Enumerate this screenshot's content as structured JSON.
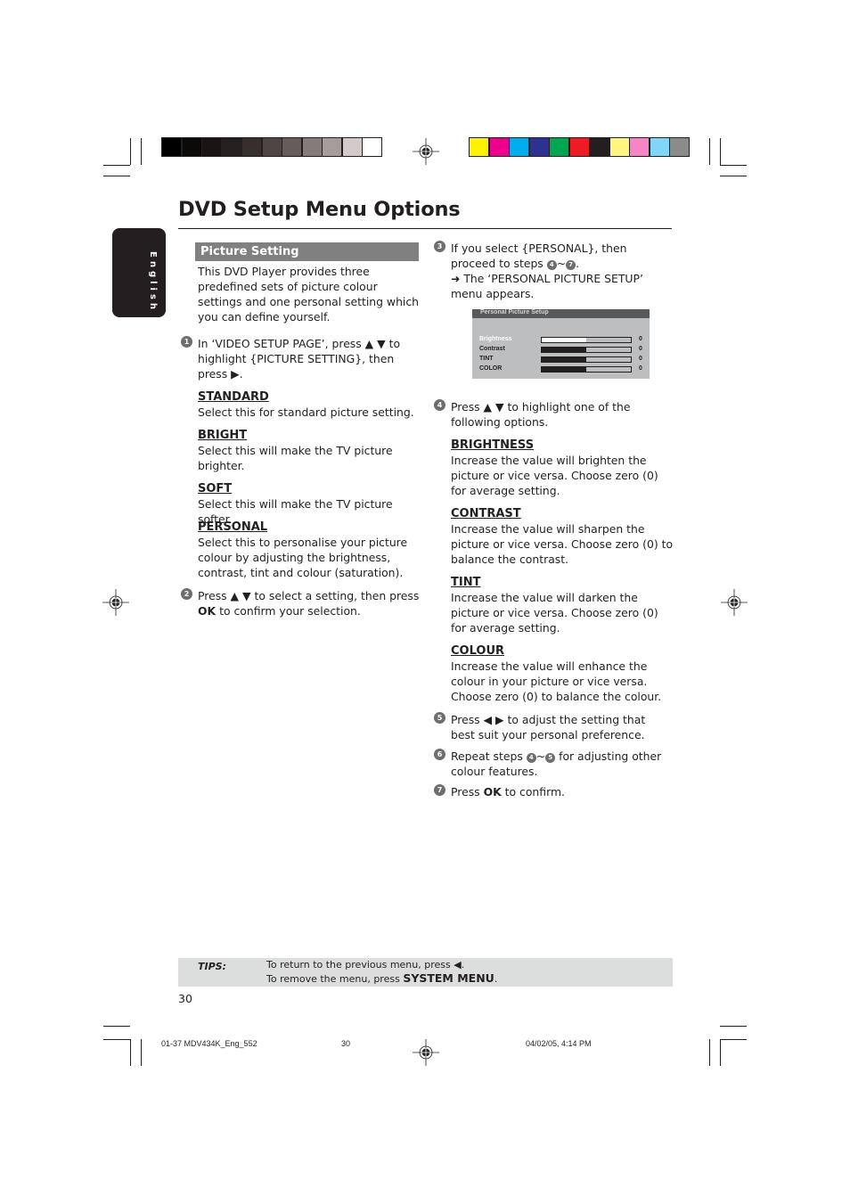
{
  "title": "DVD Setup Menu Options",
  "language_tab": "English",
  "colors": {
    "grayscale_swatches": [
      "#000000",
      "#0c0a09",
      "#1a1514",
      "#242020",
      "#372f2e",
      "#4f4543",
      "#665c5a",
      "#857b79",
      "#a59c9b",
      "#d2c9c8",
      "#ffffff"
    ],
    "color_swatches": [
      "#fff200",
      "#ec008c",
      "#00aeef",
      "#2e3192",
      "#00a651",
      "#ed1c24",
      "#231f20",
      "#fff57f",
      "#f784c5",
      "#7fd6f7",
      "#8c8b8b"
    ],
    "section_header_bg": "#808080",
    "tips_bg": "#dcdddd"
  },
  "left": {
    "section_header": "Picture Setting",
    "intro": "This DVD Player provides three predefined sets of picture colour settings and one personal setting which you can define yourself.",
    "step1": {
      "num": "1",
      "text": "In ‘VIDEO SETUP PAGE’, press ▲ ▼ to highlight {PICTURE SETTING}, then press ▶."
    },
    "options": [
      {
        "head": "STANDARD",
        "text": "Select this for standard picture setting."
      },
      {
        "head": "BRIGHT",
        "text": "Select this will make the TV picture brighter."
      },
      {
        "head": "SOFT",
        "text": "Select this will make the TV picture softer."
      },
      {
        "head": "PERSONAL",
        "text": "Select this to personalise your picture colour by adjusting the brightness, contrast, tint and colour (saturation)."
      }
    ],
    "step2": {
      "num": "2",
      "pre": "Press ▲ ▼ to select a setting, then press ",
      "bold": "OK",
      "post": " to confirm your selection."
    }
  },
  "right": {
    "step3": {
      "num": "3",
      "line1": "If you select {PERSONAL}, then proceed to steps ",
      "n1": "4",
      "tilde": "~",
      "n2": "7",
      "dot": ".",
      "result": "➜ The ‘PERSONAL PICTURE SETUP’ menu appears."
    },
    "osd": {
      "title": "Personal Picture Setup",
      "rows": [
        {
          "label": "Brightness",
          "value": "0",
          "level": 0.5,
          "highlighted": true
        },
        {
          "label": "Contrast",
          "value": "0",
          "level": 0.5,
          "highlighted": false
        },
        {
          "label": "TINT",
          "value": "0",
          "level": 0.5,
          "highlighted": false
        },
        {
          "label": "COLOR",
          "value": "0",
          "level": 0.5,
          "highlighted": false
        }
      ]
    },
    "step4": {
      "num": "4",
      "text": "Press ▲ ▼ to highlight one of the following options."
    },
    "options": [
      {
        "head": "BRIGHTNESS",
        "text": "Increase the value will brighten the picture or vice versa. Choose zero (0) for average setting."
      },
      {
        "head": "CONTRAST",
        "text": "Increase the value will sharpen the picture or vice versa.  Choose zero (0) to balance the contrast."
      },
      {
        "head": "TINT",
        "text": "Increase the value will darken the picture or vice versa.  Choose zero (0) for average setting."
      },
      {
        "head": "COLOUR",
        "text": "Increase the value will enhance the colour in your picture or vice versa. Choose zero (0) to balance the colour."
      }
    ],
    "step5": {
      "num": "5",
      "text": "Press ◀ ▶ to adjust the setting that best suit your personal preference."
    },
    "step6": {
      "num": "6",
      "pre": "Repeat steps ",
      "n1": "4",
      "tilde": "~",
      "n2": "5",
      "post": " for adjusting other colour features."
    },
    "step7": {
      "num": "7",
      "pre": "Press ",
      "bold": "OK",
      "post": " to confirm."
    }
  },
  "tips": {
    "label": "TIPS:",
    "line1": "To return to the previous menu, press ◀.",
    "line2_pre": "To remove the menu, press ",
    "line2_bold": "SYSTEM MENU",
    "line2_post": "."
  },
  "page_number": "30",
  "footer": {
    "file": "01-37 MDV434K_Eng_552",
    "page": "30",
    "date": "04/02/05, 4:14 PM"
  }
}
